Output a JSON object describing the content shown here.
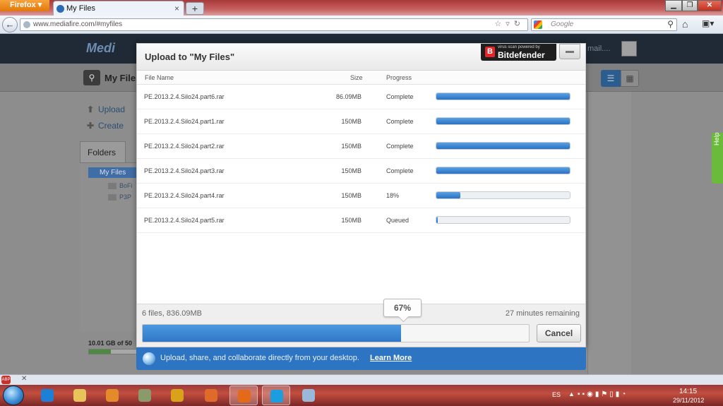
{
  "browser": {
    "menu_button": "Firefox ▾",
    "tab_title": "My Files",
    "tab_close": "×",
    "new_tab": "+",
    "url": "www.mediafire.com/#myfiles",
    "url_icons": "☆▿↻",
    "search_placeholder": "Google",
    "window_controls": [
      "▁",
      "❐",
      "✕"
    ]
  },
  "mediafire": {
    "logo": "Medi",
    "email": "mail....",
    "toolbar_title": "My Files",
    "sidebar": {
      "upload": "Upload",
      "create": "Create",
      "folders_tab": "Folders",
      "tree_root": "My Files",
      "tree_children": [
        "BoFi",
        "P3P"
      ],
      "storage": "10.01 GB of 50"
    },
    "help": "Help"
  },
  "dialog": {
    "title": "Upload to \"My Files\"",
    "bitdefender_small": "virus scan powered by",
    "bitdefender_brand": "Bitdefender",
    "columns": {
      "name": "File Name",
      "size": "Size",
      "progress": "Progress"
    },
    "files": [
      {
        "name": "PE.2013.2.4.Silo24.part6.rar",
        "size": "86.09MB",
        "status": "Complete",
        "progress": 1.0
      },
      {
        "name": "PE.2013.2.4.Silo24.part1.rar",
        "size": "150MB",
        "status": "Complete",
        "progress": 1.0
      },
      {
        "name": "PE.2013.2.4.Silo24.part2.rar",
        "size": "150MB",
        "status": "Complete",
        "progress": 1.0
      },
      {
        "name": "PE.2013.2.4.Silo24.part3.rar",
        "size": "150MB",
        "status": "Complete",
        "progress": 1.0
      },
      {
        "name": "PE.2013.2.4.Silo24.part4.rar",
        "size": "150MB",
        "status": "18%",
        "progress": 0.18
      },
      {
        "name": "PE.2013.2.4.Silo24.part5.rar",
        "size": "150MB",
        "status": "Queued",
        "progress": 0.0
      }
    ],
    "summary": "6 files, 836.09MB",
    "remaining": "27 minutes remaining",
    "overall_percent_label": "67%",
    "overall_progress": 0.67,
    "cancel": "Cancel"
  },
  "promo": {
    "text": "Upload, share, and collaborate directly from your desktop.",
    "link": "Learn More"
  },
  "taskbar": {
    "language": "ES",
    "time": "14:15",
    "date": "29/11/2012",
    "apps": [
      {
        "name": "internet-explorer-icon",
        "color": "#1e7fd6"
      },
      {
        "name": "file-explorer-icon",
        "color": "#e8c35a"
      },
      {
        "name": "media-player-icon",
        "color": "#e48a2a"
      },
      {
        "name": "tool-icon",
        "color": "#8a9a6a"
      },
      {
        "name": "chrome-icon",
        "color": "#d9a21a"
      },
      {
        "name": "control-panel-icon",
        "color": "#e06a2a"
      },
      {
        "name": "firefox-icon",
        "color": "#e46a1a"
      },
      {
        "name": "skype-icon",
        "color": "#1a9ee0"
      },
      {
        "name": "notes-icon",
        "color": "#9ab8d8"
      }
    ]
  },
  "colors": {
    "accent": "#2f78c8",
    "banner": "#2d75c2",
    "help": "#6aba3c"
  }
}
